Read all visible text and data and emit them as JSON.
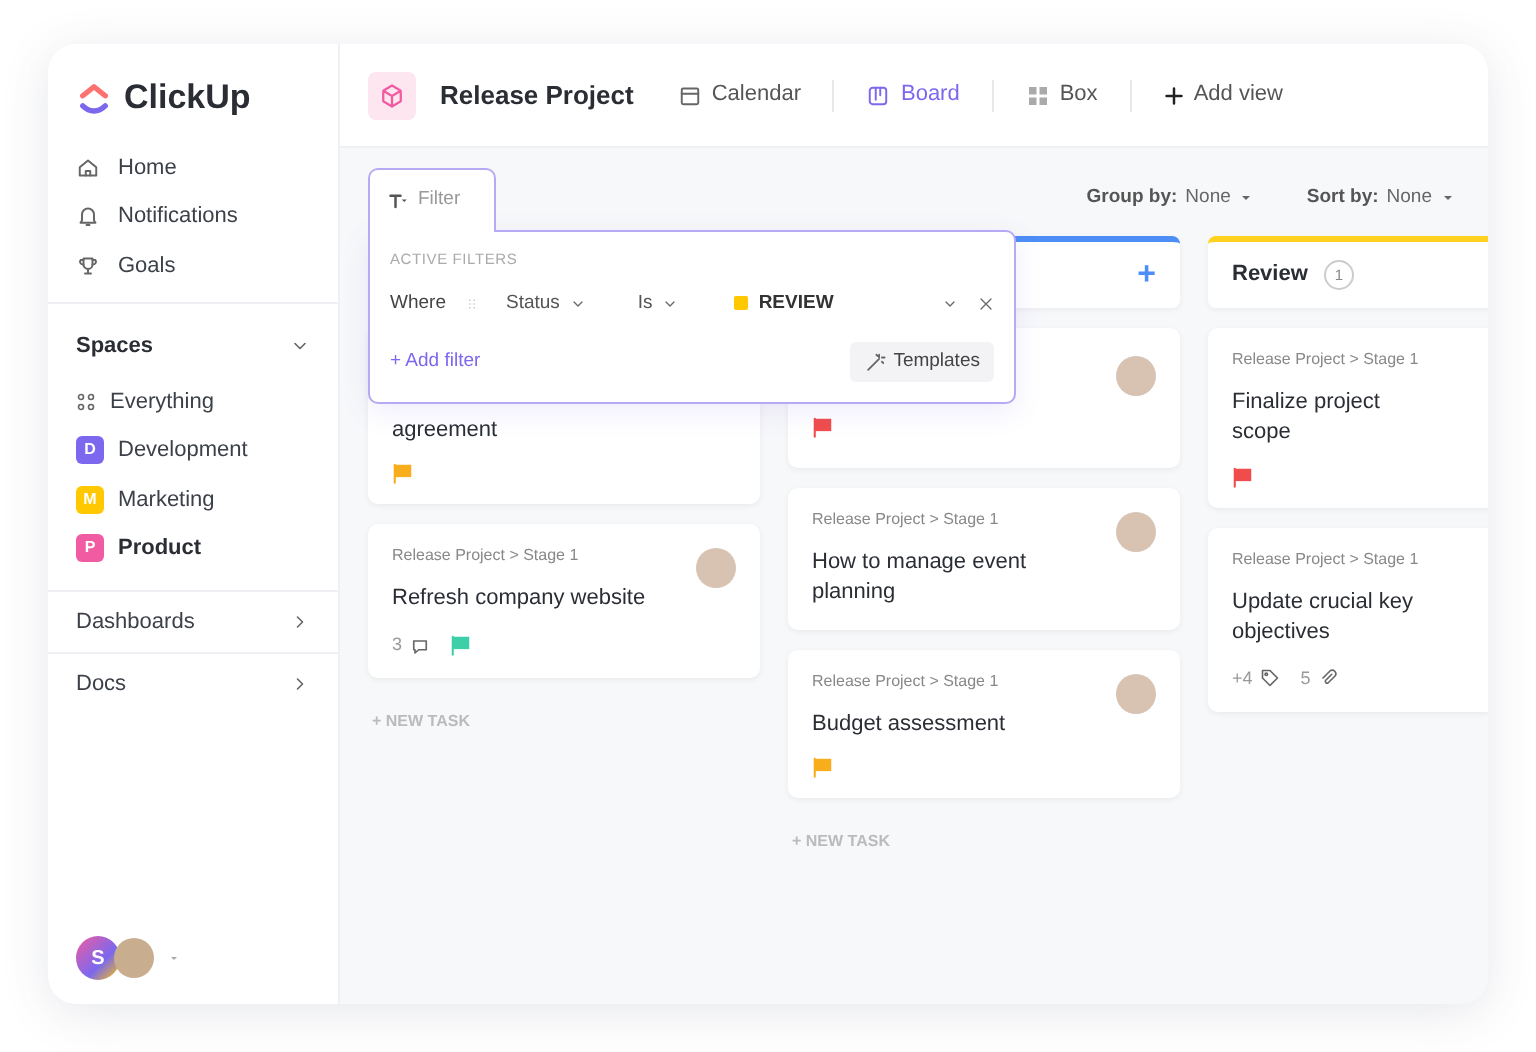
{
  "sidebar": {
    "logo": "ClickUp",
    "nav": [
      {
        "kind": "home",
        "label": "Home"
      },
      {
        "kind": "bell",
        "label": "Notifications"
      },
      {
        "kind": "trophy",
        "label": "Goals"
      }
    ],
    "spaces_title": "Spaces",
    "everything": "Everything",
    "spaces": [
      {
        "initial": "D",
        "label": "Development",
        "color": "#7b68ee",
        "selected": false
      },
      {
        "initial": "M",
        "label": "Marketing",
        "color": "#ffc800",
        "selected": false
      },
      {
        "initial": "P",
        "label": "Product",
        "color": "#f15ba1",
        "selected": true
      }
    ],
    "sections": [
      "Dashboards",
      "Docs"
    ],
    "user_initial": "S"
  },
  "header": {
    "project": "Release Project",
    "views": [
      {
        "kind": "calendar",
        "label": "Calendar",
        "selected": false
      },
      {
        "kind": "board",
        "label": "Board",
        "selected": true
      },
      {
        "kind": "box",
        "label": "Box",
        "selected": false
      }
    ],
    "add_view": "Add view"
  },
  "toolbar": {
    "filter": "Filter",
    "group_label": "Group by:",
    "group_value": "None",
    "sort_label": "Sort by:",
    "sort_value": "None"
  },
  "filter_popup": {
    "heading": "ACTIVE FILTERS",
    "where": "Where",
    "field": "Status",
    "operator": "Is",
    "status": {
      "label": "REVIEW",
      "color": "#ffc800"
    },
    "add_filter": "+ Add filter",
    "templates": "Templates"
  },
  "columns": [
    {
      "cards": [
        {
          "title": "agreement",
          "color": "#f8ae1c"
        },
        {
          "breadcrumb": "Release Project > Stage 1",
          "title": "Refresh company website",
          "avatar": true,
          "meta": [
            {
              "kind": "comments",
              "text": "3"
            }
          ],
          "color": "#3dcfa7"
        }
      ],
      "new_task": "+ NEW TASK"
    },
    {
      "color": "#4c8ef5",
      "add": "+",
      "cards": [
        {
          "avatar": true,
          "color": "#f04c4c"
        },
        {
          "breadcrumb": "Release Project > Stage 1",
          "title": "How to manage event planning",
          "avatar": true
        },
        {
          "breadcrumb": "Release Project > Stage 1",
          "title": "Budget assessment",
          "avatar": true,
          "color": "#f8ae1c"
        }
      ],
      "new_task": "+ NEW TASK"
    },
    {
      "color": "#ffd21f",
      "title": "Review",
      "count": "1",
      "cards": [
        {
          "breadcrumb": "Release Project > Stage 1",
          "title": "Finalize project scope",
          "color": "#f04c4c"
        },
        {
          "breadcrumb": "Release Project > Stage 1",
          "title": "Update crucial key objectives",
          "meta": [
            {
              "kind": "tags",
              "text": "+4"
            },
            {
              "kind": "attachments",
              "text": "5"
            }
          ]
        }
      ]
    }
  ]
}
